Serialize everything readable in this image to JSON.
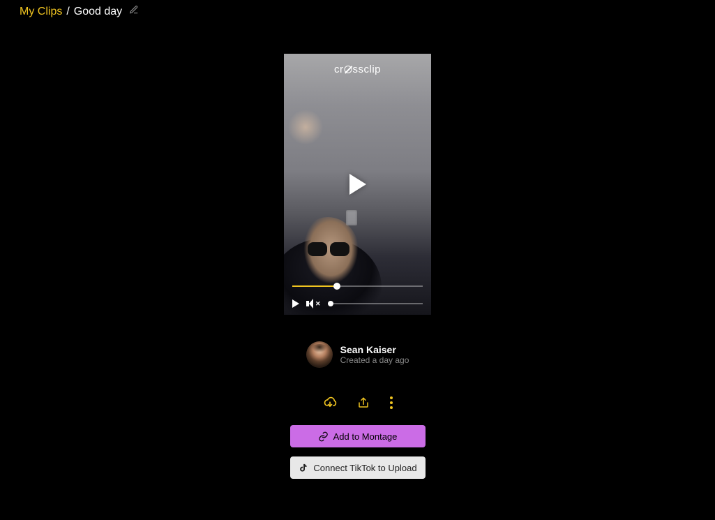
{
  "breadcrumb": {
    "root": "My Clips",
    "separator": "/",
    "current": "Good day"
  },
  "player": {
    "watermark": "crossclip",
    "progress_percent": 34,
    "volume_percent": 0
  },
  "author": {
    "name": "Sean Kaiser",
    "created": "Created a day ago"
  },
  "icons": {
    "download": "download-icon",
    "share": "share-icon",
    "more": "more-icon"
  },
  "buttons": {
    "montage": "Add to Montage",
    "tiktok": "Connect TikTok to Upload"
  },
  "colors": {
    "accent": "#f0c420",
    "primary_button": "#cb6ce6",
    "secondary_button": "#e8e8e8"
  }
}
